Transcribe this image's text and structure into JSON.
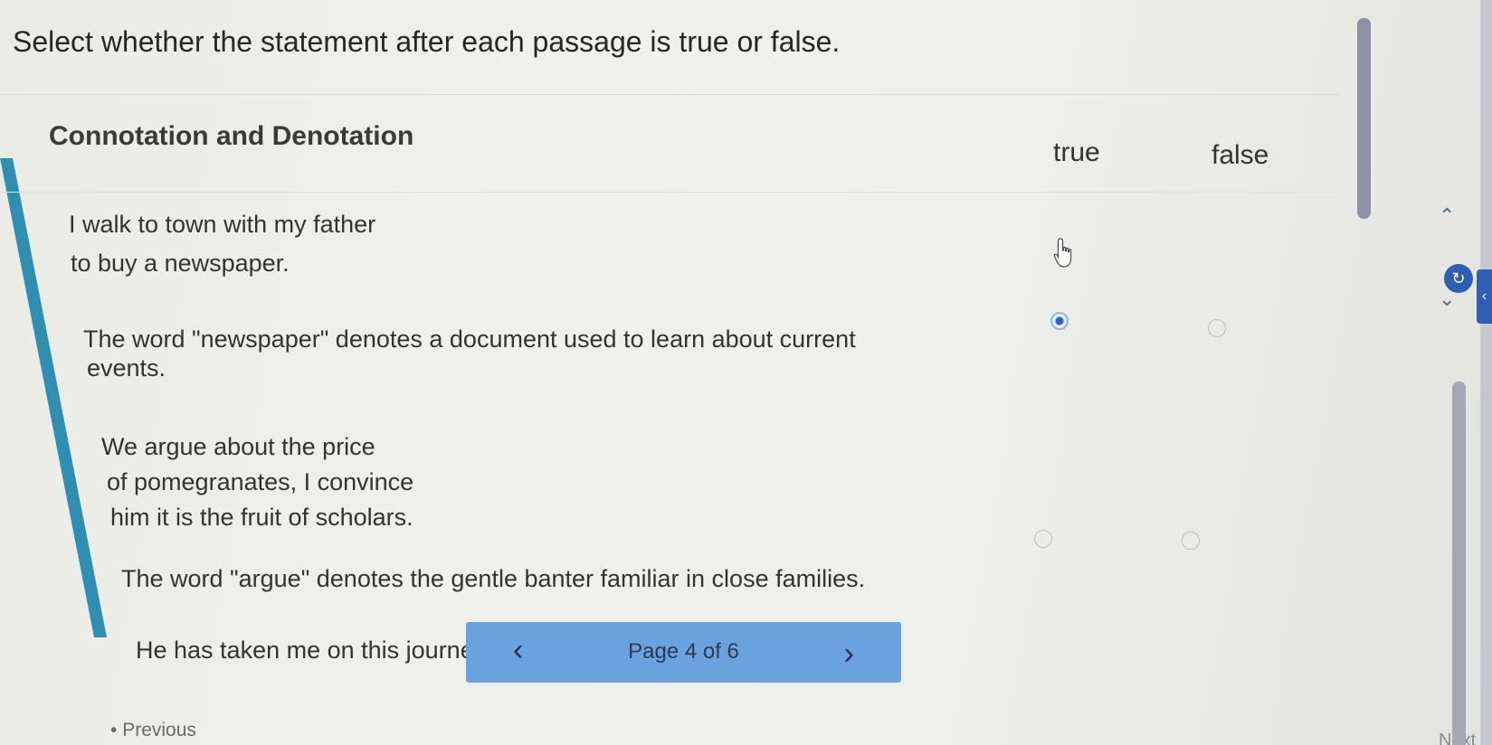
{
  "instructions": "Select whether the statement after each passage is true or false.",
  "question": {
    "title": "Connotation and Denotation",
    "columns": {
      "true_label": "true",
      "false_label": "false"
    }
  },
  "items": [
    {
      "passage_lines": [
        "I walk to town with my father",
        "to buy a newspaper."
      ],
      "statement_lines": [
        "The word \"newspaper\" denotes a document used to learn about current",
        "events."
      ],
      "selected": "true"
    },
    {
      "passage_lines": [
        "We argue about the price",
        "of pomegranates, I convince",
        "him it is the fruit of scholars."
      ],
      "statement_lines": [
        "The word \"argue\" denotes the gentle banter familiar in close families."
      ],
      "selected": null
    },
    {
      "passage_lines": [
        "He has taken me on this journe"
      ],
      "statement_lines": [],
      "selected": null
    }
  ],
  "pager": {
    "label": "Page 4 of 6",
    "prev_icon": "chevron-left-icon",
    "next_icon": "chevron-right-icon"
  },
  "navigation": {
    "previous_label": "Previous",
    "next_label": "Next"
  },
  "icons": {
    "cursor": "hand-pointer-icon",
    "toolbar_up": "chevron-up-icon",
    "toolbar_down": "chevron-down-icon",
    "toolbar_button": "refresh-icon"
  },
  "colors": {
    "accent_bar": "#2f8fb0",
    "pager_bg": "#6aa2de",
    "selected_radio": "#2b63c4",
    "toolbar_button": "#2e5fb3"
  }
}
